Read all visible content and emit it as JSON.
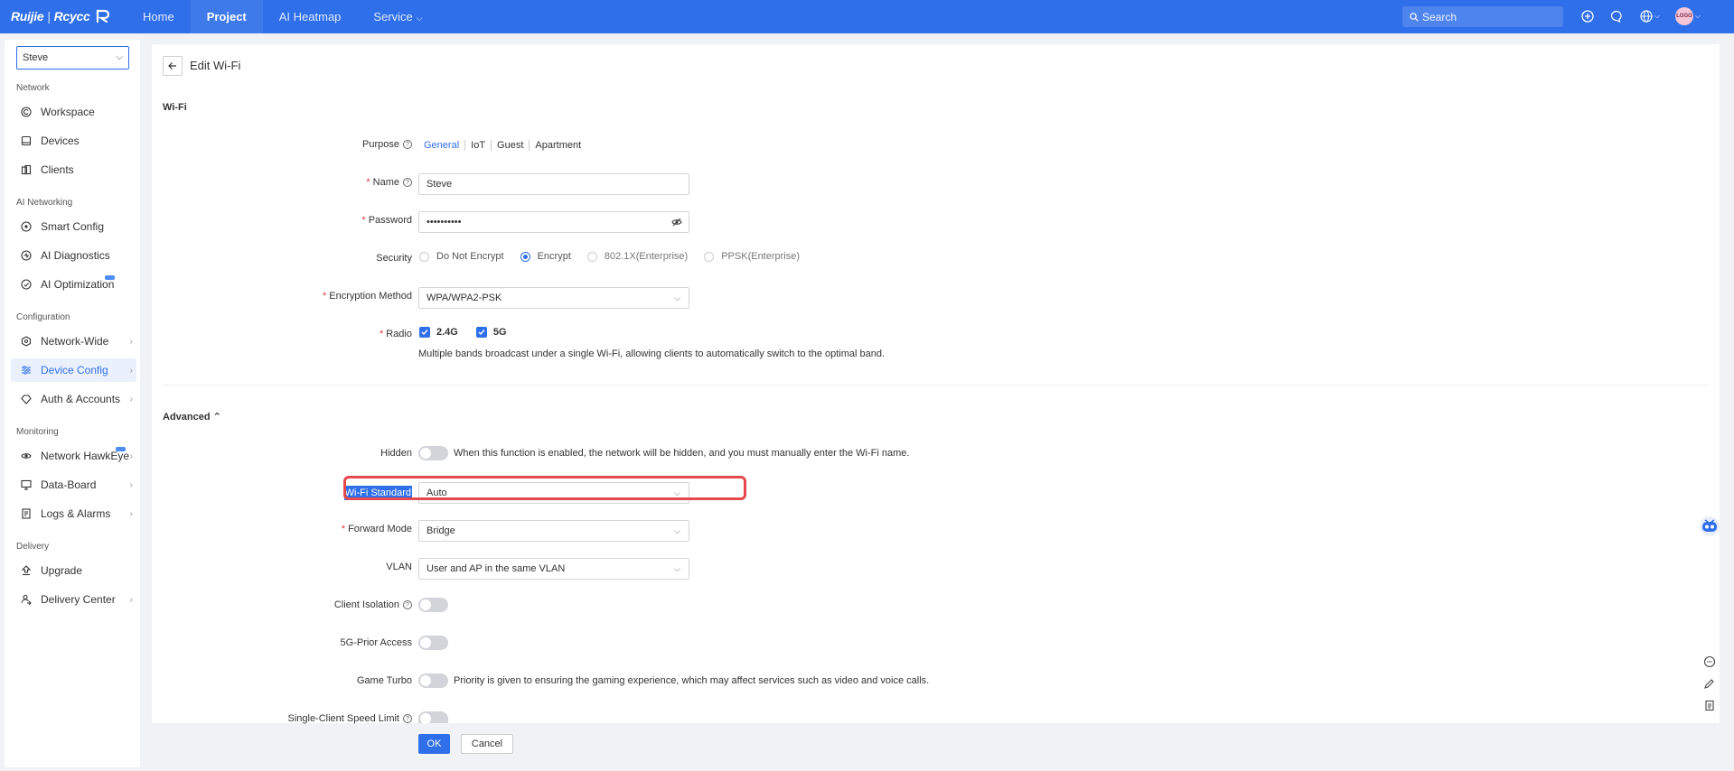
{
  "topbar": {
    "logo_brand": "Ruijie",
    "logo_product": "Rcycc",
    "nav": [
      {
        "label": "Home"
      },
      {
        "label": "Project"
      },
      {
        "label": "AI Heatmap"
      },
      {
        "label": "Service"
      }
    ],
    "search_placeholder": "Search",
    "avatar_text": "LOGO"
  },
  "sidebar": {
    "site": "Steve",
    "groups": {
      "network": "Network",
      "ai_networking": "AI Networking",
      "configuration": "Configuration",
      "monitoring": "Monitoring",
      "delivery": "Delivery"
    },
    "items": {
      "workspace": "Workspace",
      "devices": "Devices",
      "clients": "Clients",
      "smart_config": "Smart Config",
      "ai_diagnostics": "AI Diagnostics",
      "ai_optimization": "AI Optimization",
      "network_wide": "Network-Wide",
      "device_config": "Device Config",
      "auth_accounts": "Auth & Accounts",
      "network_hawkeye": "Network HawkEye",
      "data_board": "Data-Board",
      "logs_alarms": "Logs & Alarms",
      "upgrade": "Upgrade",
      "delivery_center": "Delivery Center"
    }
  },
  "page": {
    "title": "Edit Wi-Fi",
    "section_wifi": "Wi-Fi",
    "section_advanced": "Advanced"
  },
  "form": {
    "purpose_label": "Purpose",
    "purpose_options": [
      "General",
      "IoT",
      "Guest",
      "Apartment"
    ],
    "name_label": "Name",
    "name_value": "Steve",
    "password_label": "Password",
    "password_value": "••••••••••",
    "security_label": "Security",
    "security_options": [
      "Do Not Encrypt",
      "Encrypt",
      "802.1X(Enterprise)",
      "PPSK(Enterprise)"
    ],
    "encryption_label": "Encryption Method",
    "encryption_value": "WPA/WPA2-PSK",
    "radio_label": "Radio",
    "radio_options": [
      "2.4G",
      "5G"
    ],
    "radio_hint": "Multiple bands broadcast under a single Wi-Fi, allowing clients to automatically switch to the optimal band.",
    "hidden_label": "Hidden",
    "hidden_hint": "When this function is enabled, the network will be hidden, and you must manually enter the Wi-Fi name.",
    "wifi_standard_label": "Wi-Fi Standard",
    "wifi_standard_value": "Auto",
    "forward_mode_label": "Forward Mode",
    "forward_mode_value": "Bridge",
    "vlan_label": "VLAN",
    "vlan_value": "User and AP in the same VLAN",
    "client_isolation_label": "Client Isolation",
    "prior_access_label": "5G-Prior Access",
    "game_turbo_label": "Game Turbo",
    "game_turbo_hint": "Priority is given to ensuring the gaming experience, which may affect services such as video and voice calls.",
    "speed_limit_label": "Single-Client Speed Limit"
  },
  "actions": {
    "ok": "OK",
    "cancel": "Cancel"
  },
  "colors": {
    "primary": "#2f6fea",
    "highlight": "#e5484d",
    "required": "#e4393c"
  }
}
